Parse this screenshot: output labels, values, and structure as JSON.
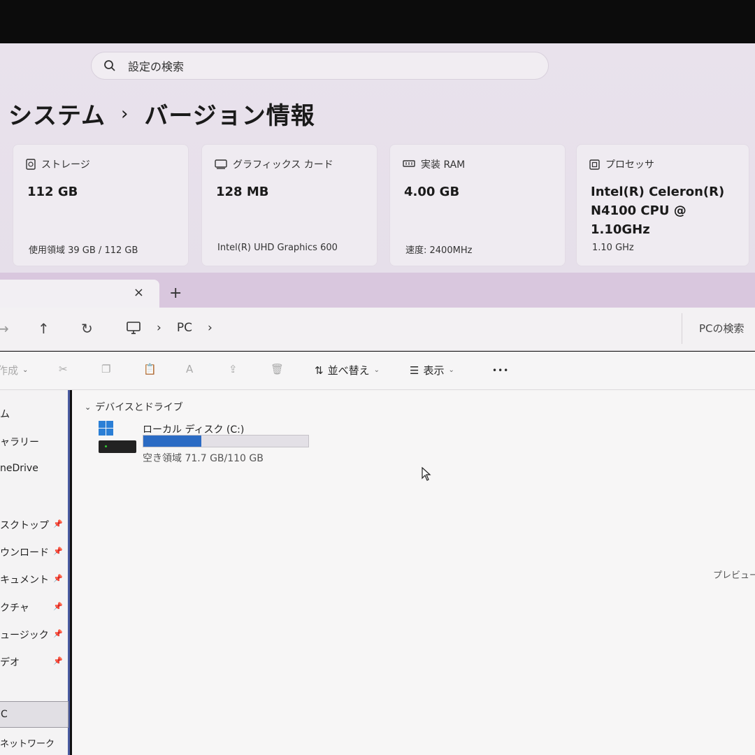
{
  "settings": {
    "search_placeholder": "設定の検索",
    "breadcrumb_parent": "システム",
    "breadcrumb_sep": "›",
    "breadcrumb_current": "バージョン情報",
    "cards": [
      {
        "label": "ストレージ",
        "value": "112 GB",
        "sub": "使用領域 39 GB / 112 GB",
        "icon": "storage-icon"
      },
      {
        "label": "グラフィックス カード",
        "value": "128 MB",
        "sub": "Intel(R) UHD Graphics 600",
        "icon": "gpu-icon"
      },
      {
        "label": "実装 RAM",
        "value": "4.00 GB",
        "sub": "速度: 2400MHz",
        "icon": "ram-icon"
      },
      {
        "label": "プロセッサ",
        "value_line1": "Intel(R) Celeron(R)",
        "value_line2": "N4100 CPU @ 1.10GHz",
        "sub": "1.10 GHz",
        "icon": "cpu-icon"
      }
    ]
  },
  "explorer": {
    "tab_close": "×",
    "tab_add": "+",
    "breadcrumb": "PC",
    "search_placeholder": "PCの検索",
    "toolbar": {
      "new_label": "作成",
      "sort_label": "並べ替え",
      "view_label": "表示",
      "more_label": "•••"
    },
    "nav_items": [
      "ム",
      "ャラリー",
      "neDrive",
      "スクトップ",
      "ウンロード",
      "キュメント",
      "クチャ",
      "ュージック",
      "デオ",
      "C",
      "ネットワーク"
    ],
    "group_title": "デバイスとドライブ",
    "drive": {
      "name": "ローカル ディスク (C:)",
      "space": "空き領域 71.7 GB/110 GB",
      "used_fraction": 0.35
    },
    "preview_text": "プレビューを",
    "accent_color": "#2b6bc4"
  }
}
